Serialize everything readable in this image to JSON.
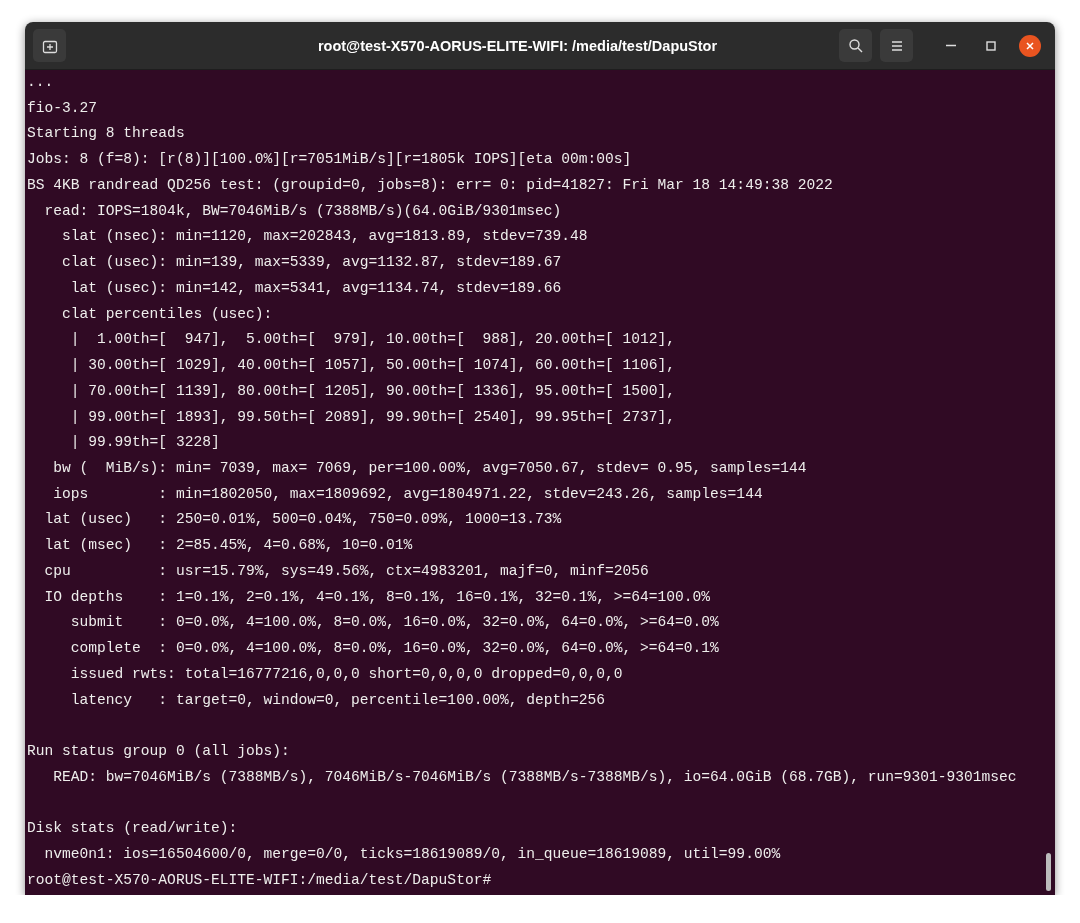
{
  "window": {
    "title": "root@test-X570-AORUS-ELITE-WIFI: /media/test/DapuStor"
  },
  "terminal": {
    "blocks": [
      [
        "...",
        "fio-3.27",
        "Starting 8 threads",
        "Jobs: 8 (f=8): [r(8)][100.0%][r=7051MiB/s][r=1805k IOPS][eta 00m:00s]",
        "BS 4KB randread QD256 test: (groupid=0, jobs=8): err= 0: pid=41827: Fri Mar 18 14:49:38 2022",
        "  read: IOPS=1804k, BW=7046MiB/s (7388MB/s)(64.0GiB/9301msec)",
        "    slat (nsec): min=1120, max=202843, avg=1813.89, stdev=739.48",
        "    clat (usec): min=139, max=5339, avg=1132.87, stdev=189.67",
        "     lat (usec): min=142, max=5341, avg=1134.74, stdev=189.66",
        "    clat percentiles (usec):",
        "     |  1.00th=[  947],  5.00th=[  979], 10.00th=[  988], 20.00th=[ 1012],",
        "     | 30.00th=[ 1029], 40.00th=[ 1057], 50.00th=[ 1074], 60.00th=[ 1106],",
        "     | 70.00th=[ 1139], 80.00th=[ 1205], 90.00th=[ 1336], 95.00th=[ 1500],",
        "     | 99.00th=[ 1893], 99.50th=[ 2089], 99.90th=[ 2540], 99.95th=[ 2737],",
        "     | 99.99th=[ 3228]",
        "   bw (  MiB/s): min= 7039, max= 7069, per=100.00%, avg=7050.67, stdev= 0.95, samples=144",
        "   iops        : min=1802050, max=1809692, avg=1804971.22, stdev=243.26, samples=144",
        "  lat (usec)   : 250=0.01%, 500=0.04%, 750=0.09%, 1000=13.73%",
        "  lat (msec)   : 2=85.45%, 4=0.68%, 10=0.01%",
        "  cpu          : usr=15.79%, sys=49.56%, ctx=4983201, majf=0, minf=2056",
        "  IO depths    : 1=0.1%, 2=0.1%, 4=0.1%, 8=0.1%, 16=0.1%, 32=0.1%, >=64=100.0%",
        "     submit    : 0=0.0%, 4=100.0%, 8=0.0%, 16=0.0%, 32=0.0%, 64=0.0%, >=64=0.0%",
        "     complete  : 0=0.0%, 4=100.0%, 8=0.0%, 16=0.0%, 32=0.0%, 64=0.0%, >=64=0.1%",
        "     issued rwts: total=16777216,0,0,0 short=0,0,0,0 dropped=0,0,0,0",
        "     latency   : target=0, window=0, percentile=100.00%, depth=256"
      ],
      [
        "Run status group 0 (all jobs):",
        "   READ: bw=7046MiB/s (7388MB/s), 7046MiB/s-7046MiB/s (7388MB/s-7388MB/s), io=64.0GiB (68.7GB), run=9301-9301msec"
      ],
      [
        "Disk stats (read/write):",
        "  nvme0n1: ios=16504600/0, merge=0/0, ticks=18619089/0, in_queue=18619089, util=99.00%"
      ]
    ],
    "prompt": "root@test-X570-AORUS-ELITE-WIFI:/media/test/DapuStor#"
  }
}
